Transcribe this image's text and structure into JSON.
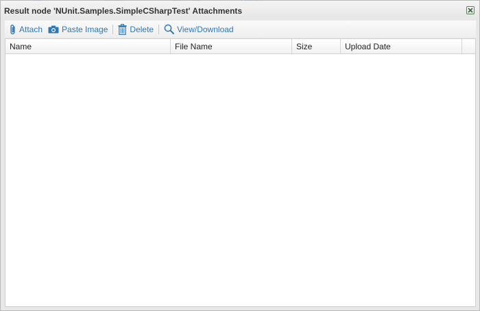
{
  "dialog": {
    "title": "Result node 'NUnit.Samples.SimpleCSharpTest' Attachments"
  },
  "toolbar": {
    "attach_label": "Attach",
    "paste_image_label": "Paste Image",
    "delete_label": "Delete",
    "view_download_label": "View/Download"
  },
  "table": {
    "columns": [
      "Name",
      "File Name",
      "Size",
      "Upload Date"
    ],
    "rows": []
  },
  "colors": {
    "link": "#2f78b5",
    "close_button_border": "#5f7f5f"
  },
  "icons": {
    "attach": "paperclip-icon",
    "paste_image": "camera-icon",
    "delete": "trash-icon",
    "view_download": "magnifier-icon",
    "close": "close-icon"
  }
}
